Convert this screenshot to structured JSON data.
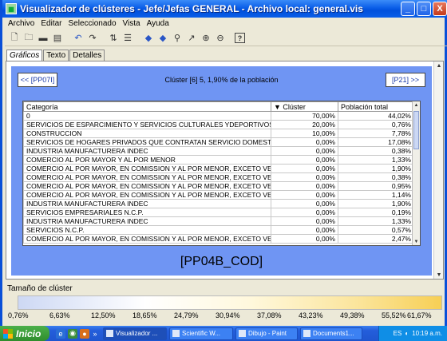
{
  "window": {
    "title": "Visualizador de clústeres - Jefe/Jefas GENERAL - Archivo local: general.vis",
    "app_icon": "cluster-app-icon",
    "buttons": {
      "minimize": "_",
      "maximize": "□",
      "close": "X"
    }
  },
  "menu": [
    "Archivo",
    "Editar",
    "Seleccionado",
    "Vista",
    "Ayuda"
  ],
  "toolbar": [
    "new-icon",
    "open-icon",
    "save-icon",
    "print-icon",
    "undo-icon",
    "redo-icon",
    "sort-icon",
    "sort-alt-icon",
    "arrow-left-icon",
    "arrow-right-icon",
    "find-icon",
    "zoom-fit-icon",
    "zoom-in-icon",
    "zoom-out-icon",
    "help-icon"
  ],
  "help_glyph": "?",
  "tabs": [
    "Gráficos",
    "Texto",
    "Detalles"
  ],
  "nav": {
    "prev_label": "<< [PP07I]",
    "next_label": "[P21] >>",
    "cluster_title": "Clúster [6] 5, 1,90% de la población"
  },
  "table": {
    "headers": {
      "category": "Categoría",
      "cluster": "▼ Clúster",
      "population": "Población total"
    },
    "rows": [
      {
        "category": "0",
        "cluster": "70,00%",
        "population": "44,02%"
      },
      {
        "category": "SERVICIOS DE ESPARCIMIENTO Y SERVICIOS CULTURALES YDEPORTIVOS",
        "cluster": "20,00%",
        "population": "0,76%"
      },
      {
        "category": "CONSTRUCCION",
        "cluster": "10,00%",
        "population": "7,78%"
      },
      {
        "category": "SERVICIOS DE HOGARES PRIVADOS QUE CONTRATAN SERVICIO DOMESTI...",
        "cluster": "0,00%",
        "population": "17,08%"
      },
      {
        "category": "INDUSTRIA MANUFACTURERA INDEC",
        "cluster": "0,00%",
        "population": "0,38%"
      },
      {
        "category": "COMERCIO AL POR MAYOR Y AL POR MENOR",
        "cluster": "0,00%",
        "population": "1,33%"
      },
      {
        "category": "COMERCIO AL POR MAYOR, EN COMISSION Y AL POR MENOR, EXCETO VE...",
        "cluster": "0,00%",
        "population": "1,90%"
      },
      {
        "category": "COMERCIO AL POR MAYOR, EN COMISSION Y AL POR MENOR, EXCETO VE...",
        "cluster": "0,00%",
        "population": "0,38%"
      },
      {
        "category": "COMERCIO AL POR MAYOR, EN COMISSION Y AL POR MENOR, EXCETO VE...",
        "cluster": "0,00%",
        "population": "0,95%"
      },
      {
        "category": "COMERCIO AL POR MAYOR, EN COMISSION Y AL POR MENOR, EXCETO VE...",
        "cluster": "0,00%",
        "population": "1,14%"
      },
      {
        "category": "INDUSTRIA MANUFACTURERA INDEC",
        "cluster": "0,00%",
        "population": "1,90%"
      },
      {
        "category": "SERVICIOS EMPRESARIALES N.C.P.",
        "cluster": "0,00%",
        "population": "0,19%"
      },
      {
        "category": "INDUSTRIA MANUFACTURERA INDEC",
        "cluster": "0,00%",
        "population": "1,33%"
      },
      {
        "category": "SERVICIOS N.C.P.",
        "cluster": "0,00%",
        "population": "0,57%"
      },
      {
        "category": "COMERCIO AL POR MAYOR, EN COMISSION Y AL POR MENOR, EXCETO VE...",
        "cluster": "0,00%",
        "population": "2,47%"
      }
    ]
  },
  "variable_label": "[PP04B_COD]",
  "cluster_size": {
    "label": "Tamaño de clúster",
    "scale": [
      "0,76%",
      "6,63%",
      "12,50%",
      "18,65%",
      "24,79%",
      "30,94%",
      "37,08%",
      "43,23%",
      "49,38%",
      "55,52%",
      "61,67%"
    ],
    "colors": {
      "low": "#cdd8f4",
      "mid": "#ffffff",
      "high": "#f7cf55"
    }
  },
  "taskbar": {
    "start_label": "Inicio",
    "quick_launch_more": "»",
    "items": [
      {
        "label": "Visualizador ...",
        "active": true
      },
      {
        "label": "Scientific W...",
        "active": false
      },
      {
        "label": "Dibujo - Paint",
        "active": false
      },
      {
        "label": "Documents1...",
        "active": false
      }
    ],
    "tray_lang": "ES",
    "clock": "10:19 a.m."
  }
}
